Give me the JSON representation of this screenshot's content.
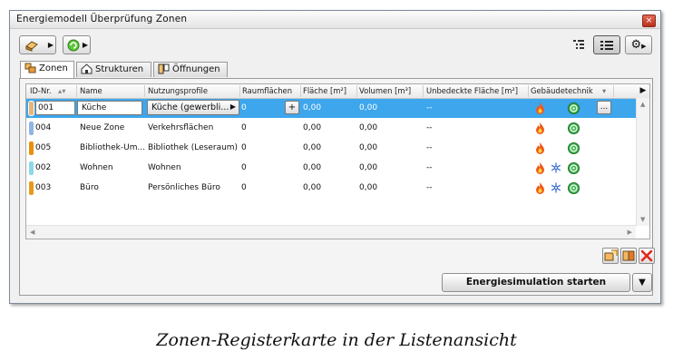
{
  "window": {
    "title": "Energiemodell Überprüfung   Zonen",
    "close_label": "×"
  },
  "toolbar": {
    "left_buttons": [
      "zone-tool-icon",
      "refresh-icon"
    ],
    "right_buttons": [
      "tree-view-icon",
      "list-view-icon",
      "settings-icon"
    ]
  },
  "tabs": [
    {
      "label": "Zonen",
      "icon": "zones-icon",
      "active": true
    },
    {
      "label": "Strukturen",
      "icon": "house-icon",
      "active": false
    },
    {
      "label": "Öffnungen",
      "icon": "openings-icon",
      "active": false
    }
  ],
  "table": {
    "headers": [
      "ID-Nr.",
      "Name",
      "Nutzungsprofile",
      "Raumflächen",
      "Fläche [m²]",
      "Volumen [m³]",
      "Unbedeckte Fläche [m²]",
      "Gebäudetechnik"
    ],
    "rows": [
      {
        "color": "#e8b47a",
        "id": "001",
        "name": "Küche",
        "profile": "Küche (gewerbli...",
        "raum": "0",
        "flaeche": "0,00",
        "volumen": "0,00",
        "unbedeckt": "--",
        "tech": [
          "fire",
          "vent"
        ],
        "selected": true
      },
      {
        "color": "#8fb4e8",
        "id": "004",
        "name": "Neue Zone",
        "profile": "Verkehrsflächen",
        "raum": "0",
        "flaeche": "0,00",
        "volumen": "0,00",
        "unbedeckt": "--",
        "tech": [
          "fire",
          "vent"
        ],
        "selected": false
      },
      {
        "color": "#e8900a",
        "id": "005",
        "name": "Bibliothek-Um...",
        "profile": "Bibliothek (Leseraum)",
        "raum": "0",
        "flaeche": "0,00",
        "volumen": "0,00",
        "unbedeckt": "--",
        "tech": [
          "fire",
          "vent"
        ],
        "selected": false
      },
      {
        "color": "#8ad8e8",
        "id": "002",
        "name": "Wohnen",
        "profile": "Wohnen",
        "raum": "0",
        "flaeche": "0,00",
        "volumen": "0,00",
        "unbedeckt": "--",
        "tech": [
          "fire",
          "snow",
          "vent"
        ],
        "selected": false
      },
      {
        "color": "#e89a1a",
        "id": "003",
        "name": "Büro",
        "profile": "Persönliches Büro",
        "raum": "0",
        "flaeche": "0,00",
        "volumen": "0,00",
        "unbedeckt": "--",
        "tech": [
          "fire",
          "snow",
          "vent"
        ],
        "selected": false
      }
    ],
    "plus_label": "+",
    "more_label": "..."
  },
  "actions": [
    "add-zone-icon",
    "edit-zone-icon",
    "delete-icon"
  ],
  "start_button_label": "Energiesimulation starten",
  "caption": "Zonen-Registerkarte in der Listenansicht"
}
